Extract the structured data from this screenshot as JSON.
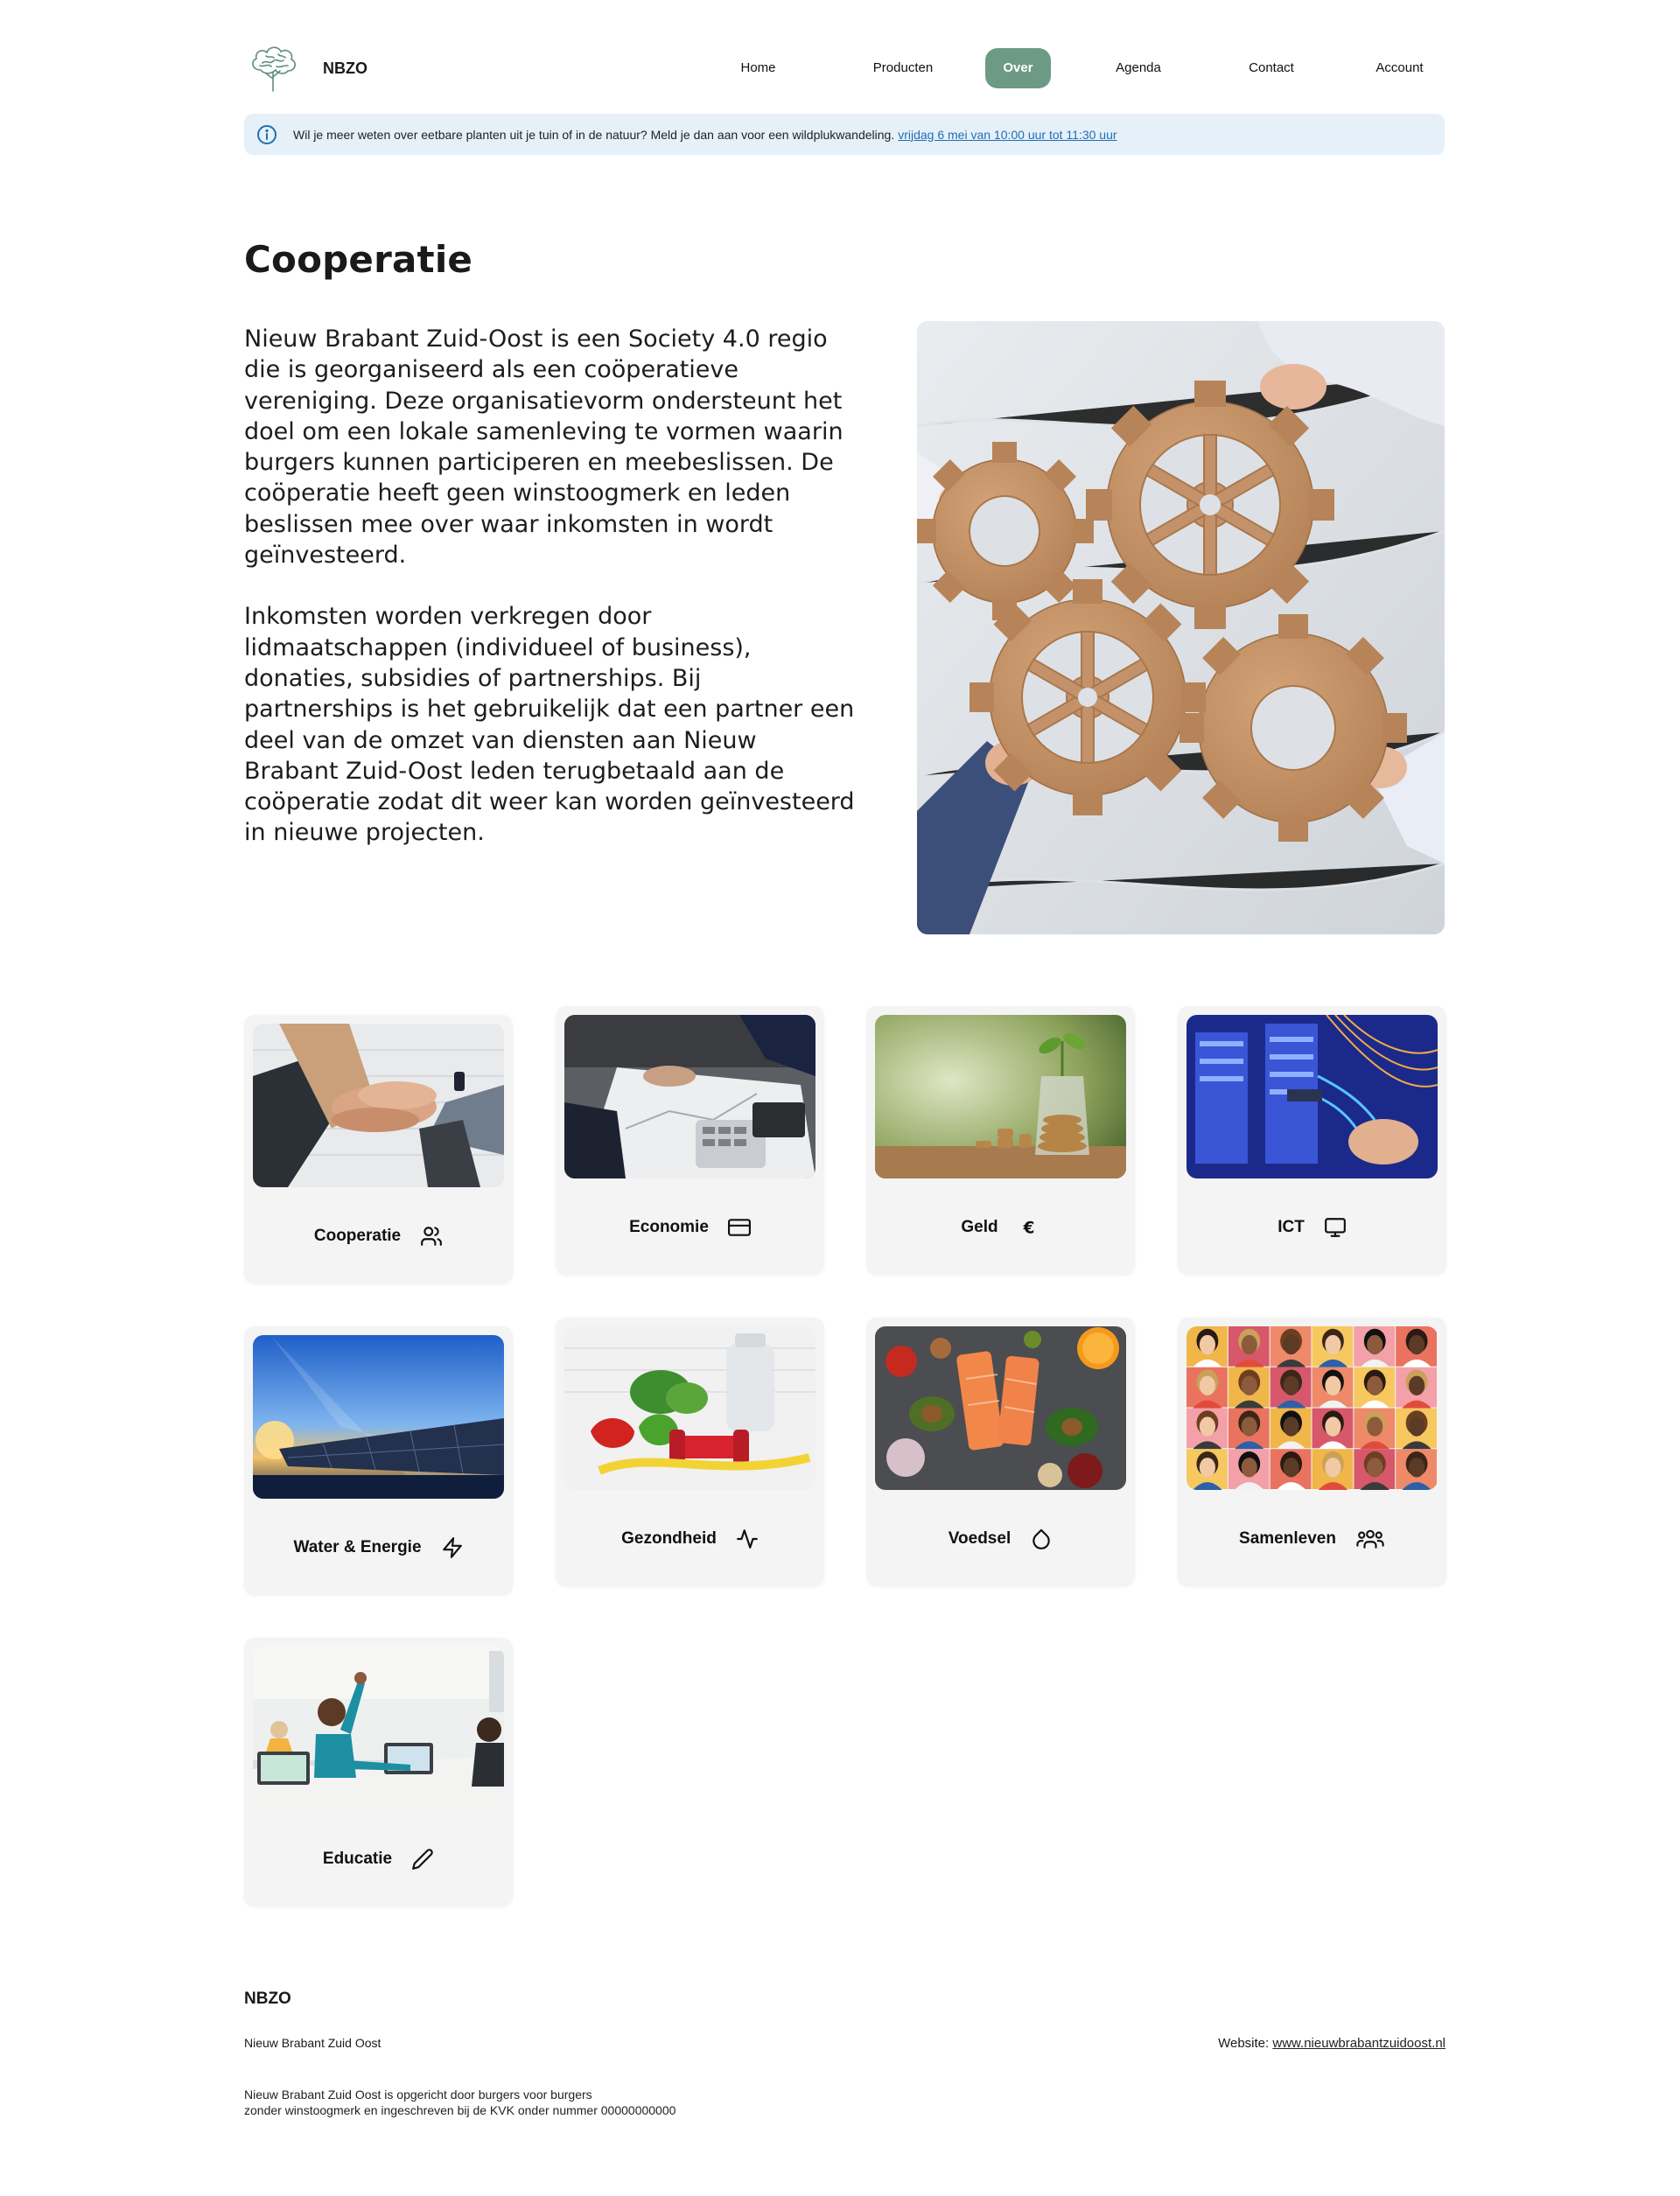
{
  "header": {
    "brand": "NBZO",
    "nav": [
      {
        "label": "Home",
        "active": false
      },
      {
        "label": "Producten",
        "active": false
      },
      {
        "label": "Over",
        "active": true
      },
      {
        "label": "Agenda",
        "active": false
      },
      {
        "label": "Contact",
        "active": false
      },
      {
        "label": "Account",
        "active": false
      }
    ]
  },
  "notice": {
    "icon": "info-icon",
    "text": "Wil je meer weten over eetbare planten uit je tuin of in de natuur? Meld je dan aan voor een wildplukwandeling.",
    "link": "vrijdag 6 mei van 10:00 uur tot 11:30 uur"
  },
  "main": {
    "title": "Cooperatie",
    "paragraphs": [
      "Nieuw Brabant Zuid-Oost is een Society 4.0 regio die is georganiseerd als een coöperatieve vereniging. Deze organisatievorm ondersteunt het doel om een lokale samenleving te vormen waarin burgers kunnen participeren en meebeslissen. De coöperatie heeft geen winstoogmerk en leden beslissen mee over waar inkomsten in wordt geïnvesteerd.",
      "Inkomsten worden verkregen door lidmaatschappen (individueel of business), donaties, subsidies of partnerships. Bij partnerships is het gebruikelijk dat een partner een deel van de omzet van diensten aan Nieuw Brabant Zuid-Oost leden terugbetaald aan de coöperatie zodat dit weer kan worden geïnvesteerd in nieuwe projecten."
    ]
  },
  "cards": [
    {
      "label": "Cooperatie",
      "icon": "users-icon"
    },
    {
      "label": "Economie",
      "icon": "credit-card-icon"
    },
    {
      "label": "Geld",
      "icon": "euro-icon"
    },
    {
      "label": "ICT",
      "icon": "monitor-icon"
    },
    {
      "label": "Water & Energie",
      "icon": "zap-icon"
    },
    {
      "label": "Gezondheid",
      "icon": "activity-icon"
    },
    {
      "label": "Voedsel",
      "icon": "droplet-icon"
    },
    {
      "label": "Samenleven",
      "icon": "group-icon"
    },
    {
      "label": "Educatie",
      "icon": "pencil-icon"
    }
  ],
  "footer": {
    "brand": "NBZO",
    "subtitle": "Nieuw Brabant Zuid Oost",
    "website_label": "Website:",
    "website_link": "www.nieuwbrabantzuidoost.nl",
    "legal_line1": "Nieuw Brabant Zuid Oost is opgericht door burgers voor burgers",
    "legal_line2": "zonder winstoogmerk en ingeschreven bij de KVK onder nummer 00000000000"
  },
  "colors": {
    "accent": "#6d9a85",
    "notice_bg": "#e6f0f9",
    "link": "#1f6fb5",
    "card_bg": "#f4f4f4"
  }
}
